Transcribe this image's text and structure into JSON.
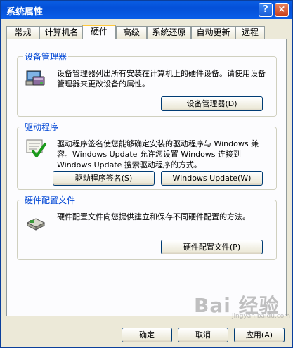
{
  "window": {
    "title": "系统属性",
    "help_label": "?",
    "close_label": "×"
  },
  "tabs": [
    {
      "label": "常规"
    },
    {
      "label": "计算机名"
    },
    {
      "label": "硬件"
    },
    {
      "label": "高级"
    },
    {
      "label": "系统还原"
    },
    {
      "label": "自动更新"
    },
    {
      "label": "远程"
    }
  ],
  "device_manager": {
    "title": "设备管理器",
    "description": "设备管理器列出所有安装在计算机上的硬件设备。请使用设备管理器来更改设备的属性。",
    "button_label": "设备管理器(D)",
    "icon": "device-manager-icon"
  },
  "drivers": {
    "title": "驱动程序",
    "description": "驱动程序签名使您能够确定安装的驱动程序与 Windows 兼容。Windows Update 允许您设置 Windows 连接到 Windows Update 搜索驱动程序的方式。",
    "signing_button_label": "驱动程序签名(S)",
    "update_button_label": "Windows Update(W)",
    "icon": "driver-signing-icon"
  },
  "hardware_profiles": {
    "title": "硬件配置文件",
    "description": "硬件配置文件向您提供建立和保存不同硬件配置的方法。",
    "button_label": "硬件配置文件(P)",
    "icon": "hardware-profiles-icon"
  },
  "footer": {
    "ok_label": "确定",
    "cancel_label": "取消",
    "apply_label": "应用(A)"
  },
  "watermark": {
    "text": "Bai 经验",
    "sub": "jingyan.baidu.com"
  }
}
